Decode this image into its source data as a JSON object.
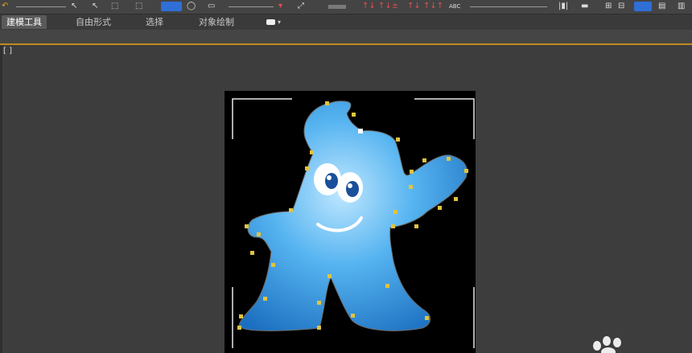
{
  "toolbar": {
    "text_tool_label": "ABC"
  },
  "ribbon": {
    "tabs": [
      {
        "label": "建模工具"
      },
      {
        "label": "自由形式"
      },
      {
        "label": "选择"
      },
      {
        "label": "对象绘制"
      }
    ]
  },
  "viewport": {
    "label": "[ ]"
  },
  "colors": {
    "accent_orange": "#c2891f",
    "selection_blue": "#2f6fd6",
    "vertex_yellow": "#e0c341",
    "mascot_blue": "#3fa4e8"
  }
}
